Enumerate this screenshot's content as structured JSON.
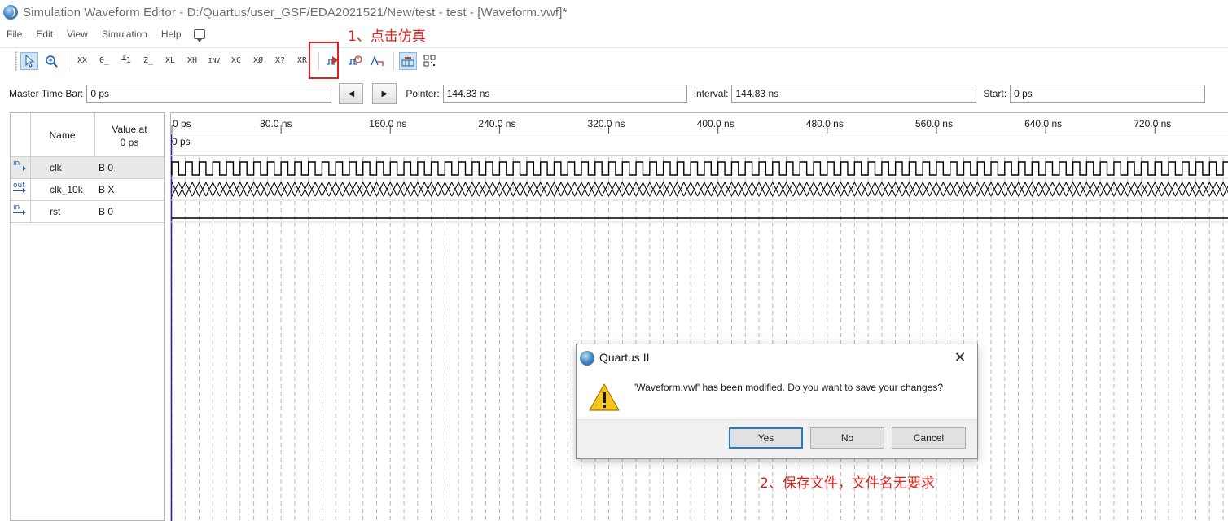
{
  "window": {
    "title": "Simulation Waveform Editor - D:/Quartus/user_GSF/EDA2021521/New/test - test - [Waveform.vwf]*"
  },
  "menu": {
    "items": [
      "File",
      "Edit",
      "View",
      "Simulation",
      "Help"
    ]
  },
  "toolbar": {
    "buttons": [
      "select-tool",
      "zoom-tool",
      "unknown-x",
      "force-0",
      "force-1",
      "force-z",
      "xl",
      "xh",
      "inv",
      "xc",
      "xo",
      "x-question",
      "xr",
      "run-functional-simulation",
      "run-timing-simulation",
      "generate-testbench",
      "snap-to-grid",
      "arrange-grid"
    ]
  },
  "annotations": {
    "step1": "1、点击仿真",
    "step2": "2、保存文件，文件名无要求"
  },
  "timebar": {
    "master_label": "Master Time Bar:",
    "master_value": "0 ps",
    "pointer_label": "Pointer:",
    "pointer_value": "144.83 ns",
    "interval_label": "Interval:",
    "interval_value": "144.83 ns",
    "start_label": "Start:",
    "start_value": "0 ps",
    "prev_symbol": "◀",
    "next_symbol": "▶"
  },
  "signals": {
    "header_name": "Name",
    "header_value": "Value at",
    "header_value_time": "0 ps",
    "rows": [
      {
        "dir": "in",
        "name": "clk",
        "value": "B 0"
      },
      {
        "dir": "out",
        "name": "clk_10k",
        "value": "B X"
      },
      {
        "dir": "in",
        "name": "rst",
        "value": "B 0"
      }
    ]
  },
  "ruler": {
    "ticks": [
      "0 ps",
      "80.0 ns",
      "160.0 ns",
      "240.0 ns",
      "320.0 ns",
      "400.0 ns",
      "480.0 ns",
      "560.0 ns",
      "640.0 ns",
      "720.0 ns"
    ],
    "pointer_time": "0 ps",
    "visible_span_ns": 775,
    "clock_period_ns": 10
  },
  "waveforms": {
    "clk": {
      "type": "clock",
      "start_level": 0
    },
    "clk_10k": {
      "type": "unknown"
    },
    "rst": {
      "type": "constant",
      "level": 0
    }
  },
  "dialog": {
    "title": "Quartus II",
    "close_symbol": "✕",
    "message": "'Waveform.vwf' has been modified. Do you want to save your changes?",
    "yes": "Yes",
    "no": "No",
    "cancel": "Cancel"
  }
}
